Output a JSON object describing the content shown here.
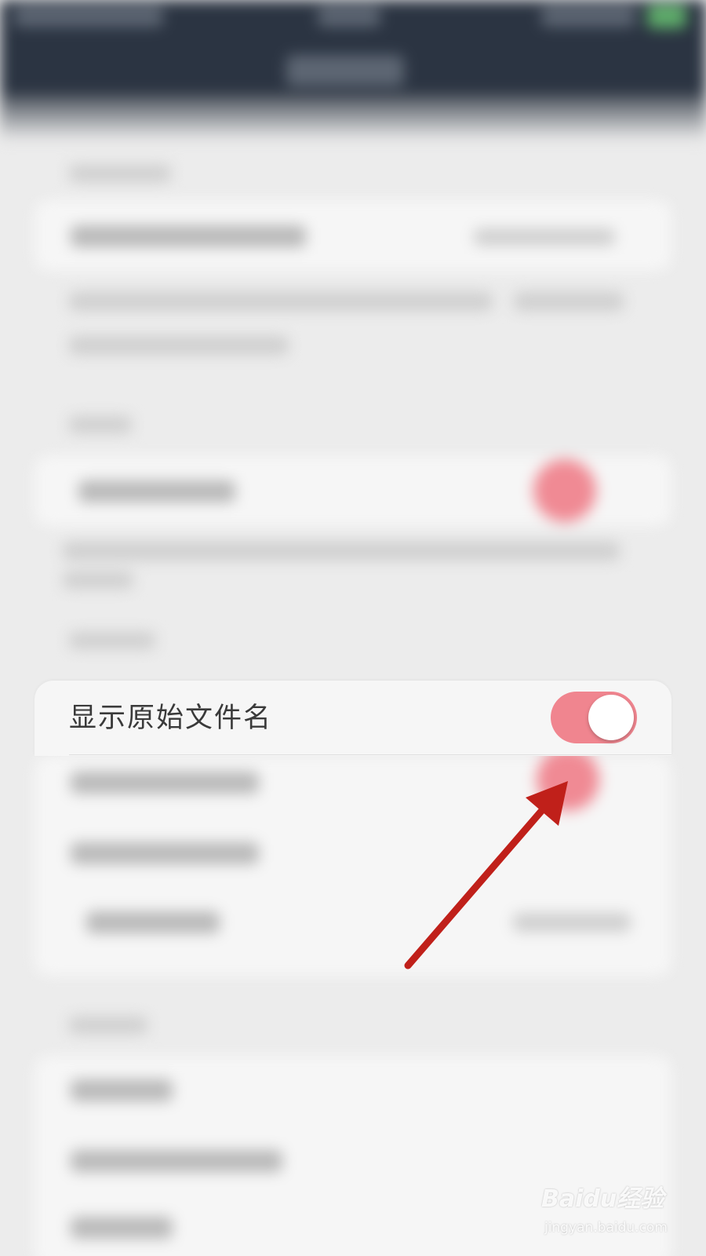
{
  "settings_row": {
    "label": "显示原始文件名",
    "toggle_on": true
  },
  "colors": {
    "toggle_on": "#f0858f",
    "arrow": "#c0201a",
    "nav_bar": "#2b3442",
    "background": "#ececec"
  },
  "annotation": {
    "icon": "arrow-pointer"
  },
  "watermark": {
    "logo_text": "Baidu经验",
    "site": "jingyan.baidu.com"
  }
}
